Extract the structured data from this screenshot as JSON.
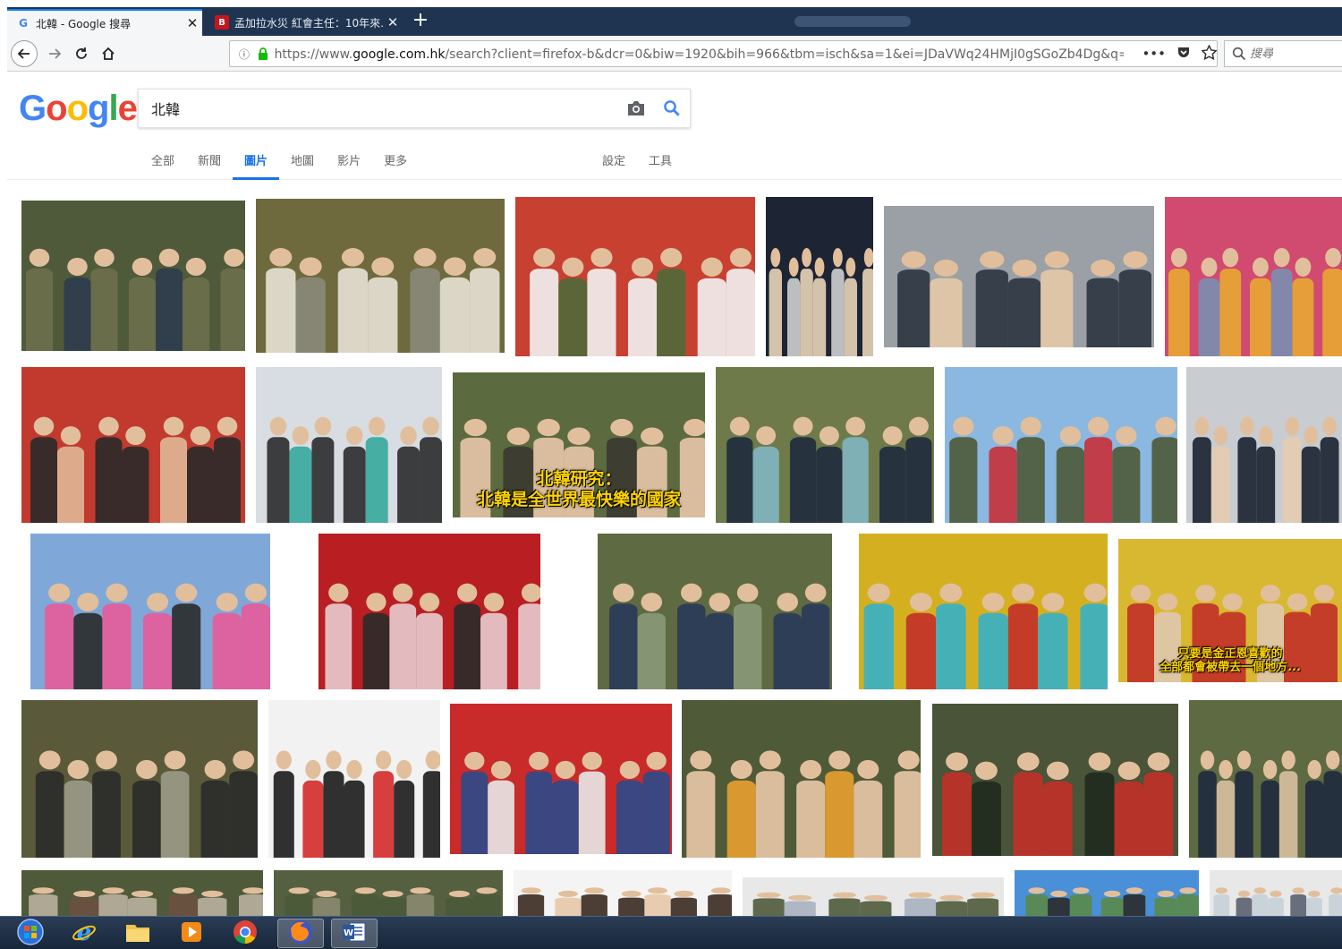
{
  "browser": {
    "tabs": [
      {
        "title": "北韓 - Google 搜尋",
        "favicon": "G",
        "active": true
      },
      {
        "title": "孟加拉水災 紅會主任：10年來…",
        "favicon": "B",
        "active": false
      }
    ],
    "new_tab": "+",
    "url_prefix": "https://www.",
    "url_domain": "google.com.hk",
    "url_rest": "/search?client=firefox-b&dcr=0&biw=1920&bih=966&tbm=isch&sa=1&ei=JDaVWq24HMjI0gSGoZb4Dg&q=北韓&oq",
    "url_more": "•••",
    "search_placeholder": "搜尋"
  },
  "google": {
    "logo_letters": [
      {
        "ch": "G",
        "color": "#4285f4"
      },
      {
        "ch": "o",
        "color": "#ea4335"
      },
      {
        "ch": "o",
        "color": "#fbbc05"
      },
      {
        "ch": "g",
        "color": "#4285f4"
      },
      {
        "ch": "l",
        "color": "#34a853"
      },
      {
        "ch": "e",
        "color": "#ea4335"
      }
    ],
    "query": "北韓",
    "tabs": [
      "全部",
      "新聞",
      "圖片",
      "地圖",
      "影片",
      "更多"
    ],
    "active_tab": "圖片",
    "tools": [
      "設定",
      "工具"
    ],
    "accent": "#1a73e8"
  },
  "images": [
    {
      "caption": "",
      "palette": [
        "#4f5a3a",
        "#6b6f4c",
        "#2e3b4f"
      ]
    },
    {
      "caption": "",
      "palette": [
        "#6e6a3e",
        "#e8e2d6",
        "#8a8a7a"
      ]
    },
    {
      "caption": "",
      "palette": [
        "#c84030",
        "#f2f2f2",
        "#4f6a3a"
      ]
    },
    {
      "caption": "",
      "palette": [
        "#1d2433",
        "#e9d4b8",
        "#cfcfcf"
      ]
    },
    {
      "caption": "",
      "palette": [
        "#9aa0a6",
        "#2c3440",
        "#e7c9a8"
      ]
    },
    {
      "caption": "",
      "palette": [
        "#d14a70",
        "#e8a832",
        "#7a8fb0"
      ]
    },
    {
      "caption": "",
      "palette": [
        "#c23a2e",
        "#2a2a2a",
        "#e0b896"
      ]
    },
    {
      "caption": "",
      "palette": [
        "#d8dde3",
        "#2b2b2b",
        "#36a89a"
      ]
    },
    {
      "caption": "北韓研究：\n北韓是全世界最快樂的國家",
      "palette": [
        "#5c6a40",
        "#e8c7a8",
        "#3a3a30"
      ]
    },
    {
      "caption": "",
      "palette": [
        "#6f7a4a",
        "#1e2a3d",
        "#7fb6c2"
      ]
    },
    {
      "caption": "",
      "palette": [
        "#8bb8e0",
        "#4c5a38",
        "#c7303a"
      ]
    },
    {
      "caption": "",
      "palette": [
        "#c9ccd1",
        "#1b2230",
        "#e6ccb0"
      ]
    },
    {
      "caption": "",
      "palette": [
        "#7fa8d8",
        "#e85a9a",
        "#2a2a2a"
      ]
    },
    {
      "caption": "",
      "palette": [
        "#b81e22",
        "#e8ccd0",
        "#2b2b2b"
      ]
    },
    {
      "caption": "",
      "palette": [
        "#5e6a42",
        "#2a3a5a",
        "#8a9a7a"
      ]
    },
    {
      "caption": "",
      "palette": [
        "#d4b020",
        "#36b0c8",
        "#c23028"
      ]
    },
    {
      "caption": "只要是金正恩喜歡的\n全部都會被帶去一個地方...",
      "palette": [
        "#d8b830",
        "#c23028",
        "#e0c8b0"
      ]
    },
    {
      "caption": "",
      "palette": [
        "#5a5a3a",
        "#2a2a2a",
        "#9a9a8a"
      ]
    },
    {
      "caption": "",
      "palette": [
        "#f2f2f2",
        "#1b1b1b",
        "#d42a2a"
      ]
    },
    {
      "caption": "",
      "palette": [
        "#c92a2a",
        "#2a4a8a",
        "#e8e8e8"
      ]
    },
    {
      "caption": "",
      "palette": [
        "#4f5a38",
        "#e8c8a8",
        "#e8a030"
      ]
    },
    {
      "caption": "",
      "palette": [
        "#4a5438",
        "#c23028",
        "#1f2a1f"
      ]
    },
    {
      "caption": "",
      "palette": [
        "#5e6a42",
        "#1e2a3d",
        "#d8c0a0"
      ]
    },
    {
      "caption": "",
      "palette": [
        "#4f5a3a",
        "#b8b0a0",
        "#6a5040"
      ]
    },
    {
      "caption": "",
      "palette": [
        "#556040",
        "#4a5a38",
        "#8a8a70"
      ]
    },
    {
      "caption": "",
      "palette": [
        "#f4f4f4",
        "#3a2a20",
        "#e8c8a8"
      ]
    },
    {
      "caption": "",
      "palette": [
        "#e8e8e8",
        "#4f5a3a",
        "#a8b0c0"
      ]
    },
    {
      "caption": "",
      "palette": [
        "#4a90d8",
        "#5a8a4a",
        "#2a2a2a"
      ]
    },
    {
      "caption": "",
      "palette": [
        "#e8e8e8",
        "#c8d0d8",
        "#5a6070"
      ]
    }
  ],
  "taskbar": [
    {
      "app": "start-orb",
      "active": false
    },
    {
      "app": "internet-explorer",
      "active": false
    },
    {
      "app": "file-explorer",
      "active": false
    },
    {
      "app": "media-player",
      "active": false
    },
    {
      "app": "chrome",
      "active": false
    },
    {
      "app": "firefox",
      "active": true
    },
    {
      "app": "word",
      "active": true
    }
  ]
}
